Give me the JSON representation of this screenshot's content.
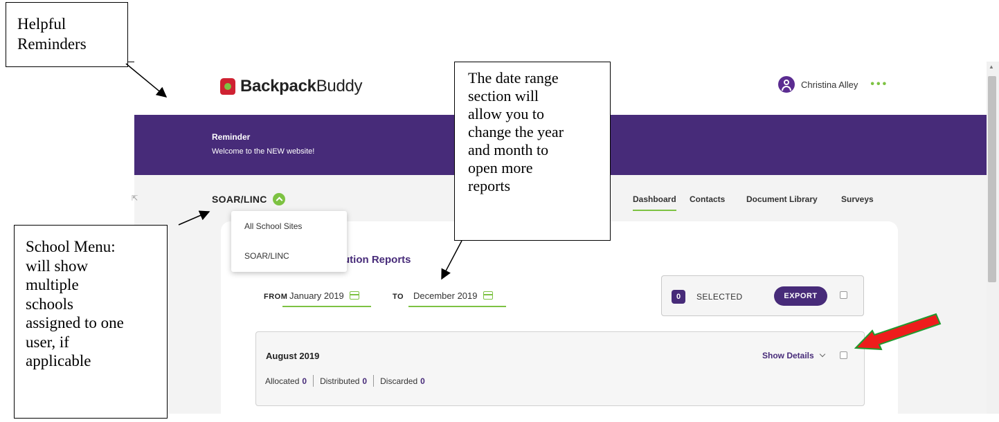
{
  "annotations": {
    "helpful_reminders": "Helpful\nReminders",
    "date_range_note": " The date range\nsection will\nallow you to\nchange the year\nand month to\nopen more\nreports",
    "school_menu_note": "School Menu:\nwill show\nmultiple\nschools\nassigned to one\nuser, if\napplicable"
  },
  "header": {
    "logo_bold": "Backpack",
    "logo_regular": "Buddy",
    "user_name": "Christina Alley",
    "more_icon": "more-dots-icon"
  },
  "banner": {
    "title": "Reminder",
    "text": "Welcome to the NEW website!"
  },
  "school_selector": {
    "name": "SOAR/LINC",
    "options": [
      "All School Sites",
      "SOAR/LINC"
    ]
  },
  "nav": {
    "items": [
      "Dashboard",
      "Contacts",
      "Document Library",
      "Surveys"
    ],
    "active": "Dashboard"
  },
  "reports": {
    "title_partial": "ution Reports",
    "from_label": "FROM",
    "from_value": "January 2019",
    "to_label": "TO",
    "to_value": "December 2019",
    "selected_count": "0",
    "selected_label": "SELECTED",
    "export_label": "EXPORT",
    "months": [
      {
        "title": "August 2019",
        "show_details": "Show Details",
        "allocated_label": "Allocated",
        "allocated": "0",
        "distributed_label": "Distributed",
        "distributed": "0",
        "discarded_label": "Discarded",
        "discarded": "0"
      }
    ]
  },
  "colors": {
    "brand_purple": "#472b79",
    "accent_green": "#7dc242",
    "logo_red": "#cf2232",
    "highlight_arrow": "#ee1c1c"
  }
}
